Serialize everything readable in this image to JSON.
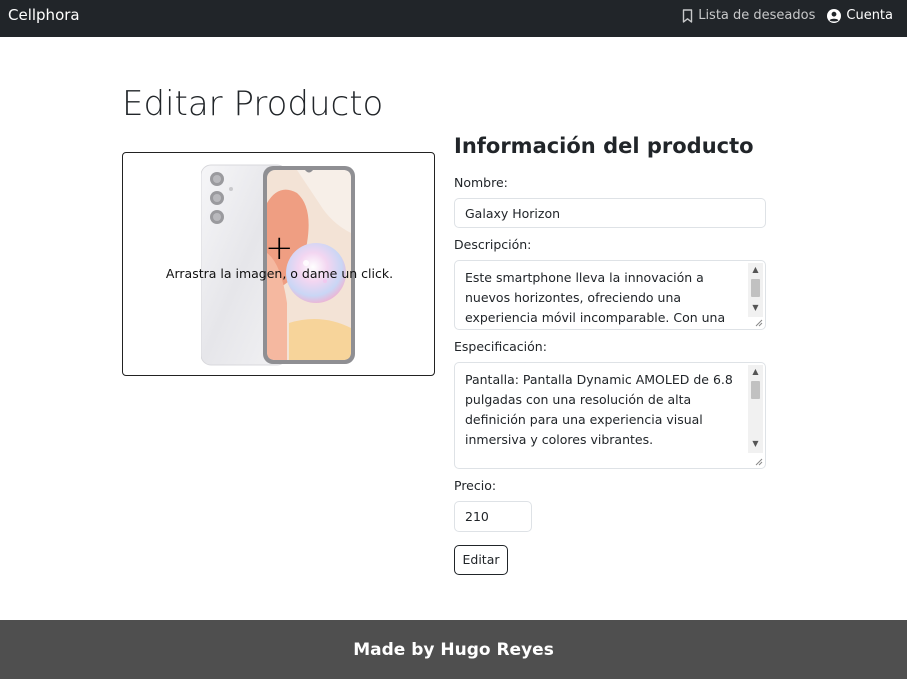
{
  "navbar": {
    "brand": "Cellphora",
    "wishlist_label": "Lista de deseados",
    "account_label": "Cuenta"
  },
  "page": {
    "title": "Editar Producto"
  },
  "dropzone": {
    "text": "Arrastra la imagen, o dame un click.",
    "plus": "+"
  },
  "form": {
    "heading": "Información del producto",
    "name_label": "Nombre:",
    "name_value": "Galaxy Horizon",
    "description_label": "Descripción:",
    "description_value": "Este smartphone lleva la innovación a nuevos horizontes, ofreciendo una experiencia móvil incomparable. Con una pantalla Dynamic",
    "spec_label": "Especificación:",
    "spec_value": "Pantalla: Pantalla Dynamic AMOLED de 6.8 pulgadas con una resolución de alta definición para una experiencia visual inmersiva y colores vibrantes.",
    "price_label": "Precio:",
    "price_value": "210",
    "submit_label": "Editar"
  },
  "footer": {
    "text": "Made by Hugo Reyes"
  },
  "colors": {
    "navbar_bg": "#212529",
    "footer_bg": "#4f4f4f"
  },
  "icons": {
    "wishlist": "bookmark-icon",
    "account": "user-circle-icon"
  }
}
